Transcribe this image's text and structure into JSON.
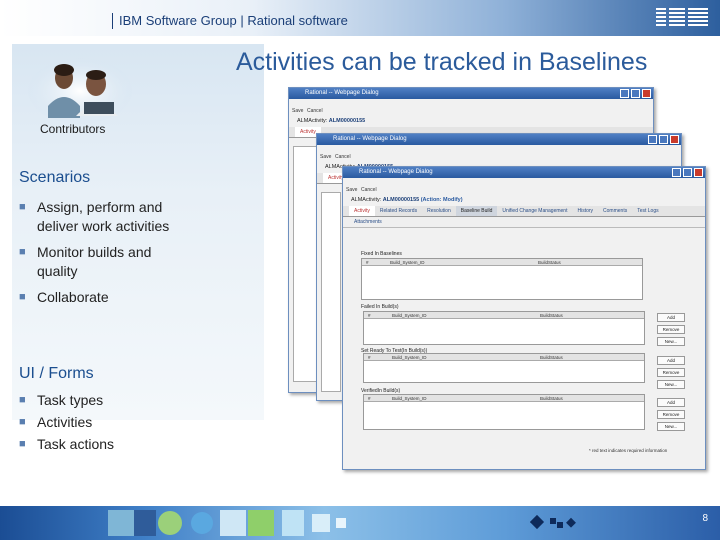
{
  "header": {
    "title": "IBM Software Group | Rational software",
    "logo": "IBM"
  },
  "slide": {
    "title": "Activities can be tracked in Baselines",
    "photo_caption": "Contributors",
    "page_number": "8"
  },
  "sections": [
    {
      "heading": "Scenarios",
      "bullets": [
        "Assign, perform and deliver work activities",
        "Monitor builds and quality",
        "Collaborate"
      ]
    },
    {
      "heading": "UI / Forms",
      "bullets": [
        "Task types",
        "Activities",
        "Task actions"
      ]
    }
  ],
  "dialogs": {
    "title_back": "Rational -- Webpage Dialog",
    "title_mid": "Rational -- Webpage Dialog",
    "title_front": "Rational -- Webpage Dialog",
    "save_label": "Save",
    "cancel_label": "Cancel",
    "record_label": "ALMActivity:",
    "record_id": "ALM00000155",
    "record_action": "(Action: Modify)",
    "tabs": [
      "Activity",
      "Related Records",
      "Resolution",
      "Baseline Build",
      "Unified Change Management",
      "History",
      "Comments",
      "Test Logs"
    ],
    "attachments_tab": "Attachments",
    "fixed_in": {
      "label": "Fixed In Baselines",
      "col1": "#",
      "col2": "Build_System_ID",
      "col3": "BuildStatus"
    },
    "failed_in": {
      "label": "Failed In Build(s)",
      "col1": "#",
      "col2": "Build_System_ID",
      "col3": "BuildStatus"
    },
    "tested_in": {
      "label": "Set Ready To Test(In Build(s))",
      "col1": "#",
      "col2": "Build_System_ID",
      "col3": "BuildStatus"
    },
    "verified_in": {
      "label": "VerifiedIn Build(s)",
      "col1": "#",
      "col2": "Build_System_ID",
      "col3": "BuildStatus"
    },
    "buttons": {
      "add": "Add",
      "remove": "Remove",
      "new": "New..."
    },
    "footnote": "* red text indicates required information"
  },
  "colors": {
    "title_blue": "#2b5b9b",
    "heading_blue": "#1b4e8f",
    "dialog_title_blue": "#2a5aa0"
  }
}
